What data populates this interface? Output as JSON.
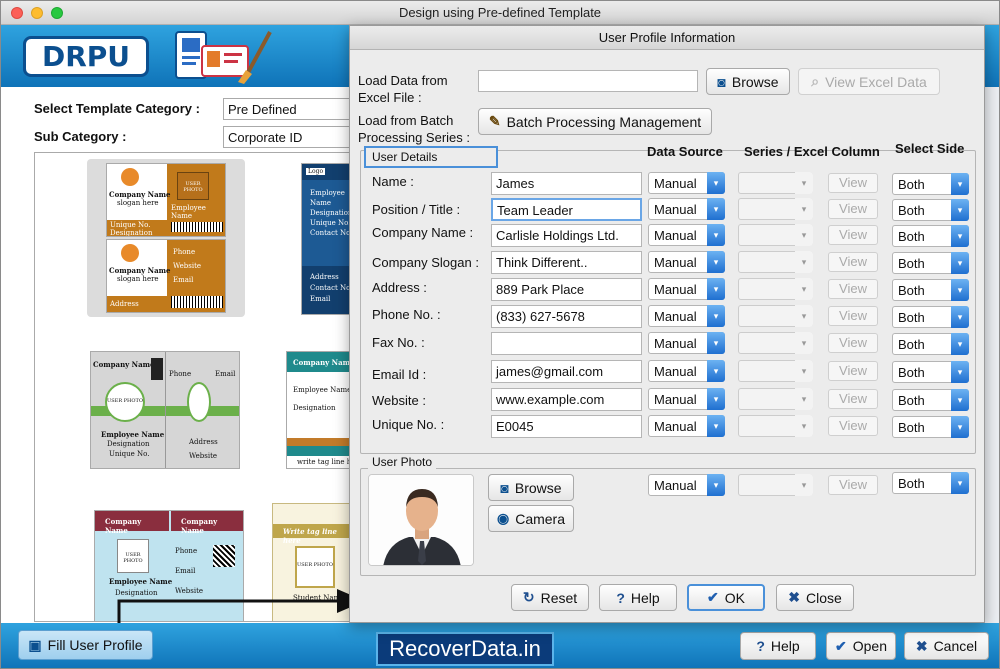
{
  "window": {
    "title": "Design using Pre-defined Template"
  },
  "banner": {
    "logo": "DRPU"
  },
  "left": {
    "template_category_label": "Select Template Category :",
    "template_category_value": "Pre Defined",
    "sub_category_label": "Sub Category :",
    "sub_category_value": "Corporate ID"
  },
  "templates": {
    "t1": {
      "company": "Company Name",
      "slogan": "slogan here",
      "photo": "USER PHOTO",
      "emp": "Employee Name",
      "unique": "Unique No.",
      "designation": "Designation",
      "phone": "Phone",
      "website": "Website",
      "email": "Email",
      "address": "Address"
    },
    "t2": {
      "logo": "Logo",
      "emp": "Employee Name",
      "designation": "Designation",
      "unique": "Unique No.",
      "contact": "Contact No.",
      "address": "Address",
      "email": "Email"
    },
    "t3": {
      "company": "Company Name",
      "photo": "USER PHOTO",
      "phone": "Phone",
      "email": "Email",
      "emp": "Employee Name",
      "designation": "Designation",
      "unique": "Unique No.",
      "address": "Address",
      "website": "Website"
    },
    "t4": {
      "company": "Company Name",
      "emp": "Employee Name",
      "designation": "Designation",
      "tag": "write tag line here"
    },
    "t5": {
      "company": "Company Name",
      "photo": "USER PHOTO",
      "emp": "Employee Name",
      "designation": "Designation",
      "phone": "Phone",
      "email": "Email",
      "website": "Website"
    },
    "t6": {
      "tag": "Write tag line here",
      "photo": "USER PHOTO",
      "emp": "Student Name"
    }
  },
  "bottom": {
    "fill_profile": "Fill User Profile",
    "recover": "RecoverData.in",
    "help": "Help",
    "open": "Open",
    "cancel": "Cancel"
  },
  "dialog": {
    "title": "User Profile Information",
    "load_excel_label": "Load Data from Excel File :",
    "browse": "Browse",
    "view_excel": "View Excel Data",
    "load_batch_label": "Load from Batch Processing Series :",
    "batch_button": "Batch Processing Management",
    "user_details": "User Details",
    "col_data_source": "Data Source",
    "col_series": "Series / Excel Column",
    "col_side": "Select Side",
    "fields": [
      {
        "label": "Name :",
        "value": "James",
        "source": "Manual",
        "side": "Both",
        "view": "View"
      },
      {
        "label": "Position / Title :",
        "value": "Team Leader",
        "source": "Manual",
        "side": "Both",
        "view": "View"
      },
      {
        "label": "Company Name :",
        "value": "Carlisle Holdings Ltd.",
        "source": "Manual",
        "side": "Both",
        "view": "View"
      },
      {
        "label": "Company Slogan :",
        "value": "Think Different..",
        "source": "Manual",
        "side": "Both",
        "view": "View"
      },
      {
        "label": "Address :",
        "value": "889 Park Place",
        "source": "Manual",
        "side": "Both",
        "view": "View"
      },
      {
        "label": "Phone No. :",
        "value": "(833) 627-5678",
        "source": "Manual",
        "side": "Both",
        "view": "View"
      },
      {
        "label": "Fax No. :",
        "value": "",
        "source": "Manual",
        "side": "Both",
        "view": "View"
      },
      {
        "label": "Email Id :",
        "value": "james@gmail.com",
        "source": "Manual",
        "side": "Both",
        "view": "View"
      },
      {
        "label": "Website :",
        "value": "www.example.com",
        "source": "Manual",
        "side": "Both",
        "view": "View"
      },
      {
        "label": "Unique No. :",
        "value": "E0045",
        "source": "Manual",
        "side": "Both",
        "view": "View"
      }
    ],
    "user_photo": "User Photo",
    "photo_browse": "Browse",
    "camera": "Camera",
    "photo_source": "Manual",
    "photo_side": "Both",
    "photo_view": "View",
    "reset": "Reset",
    "help": "Help",
    "ok": "OK",
    "close": "Close"
  },
  "colors": {
    "banner": "#1a8ad0",
    "accent": "#1f6fd0",
    "template_orange": "#c17a1b"
  }
}
